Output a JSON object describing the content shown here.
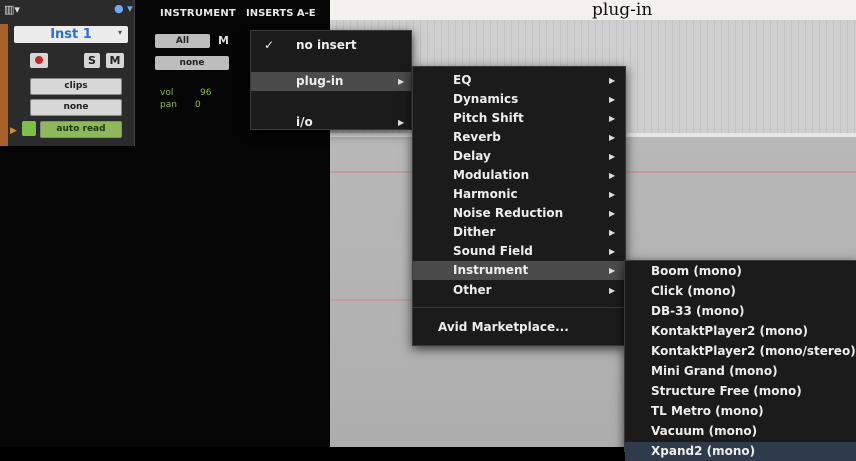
{
  "caption_fragment": "plug-in",
  "top_toolbar": {
    "menu_glyph": "▥▾",
    "bullet": "● ▾",
    "col_instrument": "INSTRUMENT",
    "col_inserts": "INSERTS A-E"
  },
  "track": {
    "name": "Inst 1",
    "solo_label": "S",
    "mute_label": "M",
    "playlist_label": "clips",
    "voice_label": "none",
    "automation_label": "auto read"
  },
  "instrument_column": {
    "channel_select": "All",
    "mute_label": "M",
    "input_select": "none",
    "vol_label": "vol",
    "vol_value": "96",
    "pan_label": "pan",
    "pan_value": "0"
  },
  "menu1": {
    "items": [
      {
        "label": "no insert",
        "checked": true,
        "check": "✓"
      },
      {
        "label": "plug-in",
        "submenu": true,
        "highlighted": true
      },
      {
        "label": "i/o",
        "submenu": true
      }
    ]
  },
  "menu2": {
    "items": [
      {
        "label": "EQ"
      },
      {
        "label": "Dynamics"
      },
      {
        "label": "Pitch Shift"
      },
      {
        "label": "Reverb"
      },
      {
        "label": "Delay"
      },
      {
        "label": "Modulation"
      },
      {
        "label": "Harmonic"
      },
      {
        "label": "Noise Reduction"
      },
      {
        "label": "Dither"
      },
      {
        "label": "Sound Field"
      },
      {
        "label": "Instrument",
        "highlighted": true
      },
      {
        "label": "Other"
      }
    ],
    "footer": "Avid Marketplace..."
  },
  "menu3": {
    "items": [
      "Boom (mono)",
      "Click (mono)",
      "DB-33 (mono)",
      "KontaktPlayer2 (mono)",
      "KontaktPlayer2 (mono/stereo)",
      "Mini Grand (mono)",
      "Structure Free (mono)",
      "TL Metro (mono)",
      "Vacuum (mono)",
      "Xpand2 (mono)"
    ]
  },
  "colors": {
    "menu_bg": "#1b1b1b",
    "menu_highlight": "#4b4b4b",
    "track_name": "#2b6fd6",
    "volume_green": "#8ac23c",
    "automation_green": "#8fb85a",
    "track_orange": "#a8602a"
  }
}
